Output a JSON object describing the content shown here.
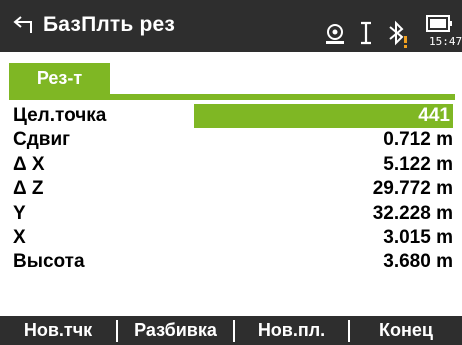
{
  "header": {
    "title": "БазПлть рез",
    "time": "15:47",
    "icons": [
      "back-arrow-icon",
      "target-prism-icon",
      "ir-measure-icon",
      "bluetooth-icon",
      "battery-icon"
    ],
    "warning_color": "#f0a020"
  },
  "tab": {
    "label": "Рез-т"
  },
  "rows": [
    {
      "label": "Цел.точка",
      "value": "441",
      "highlighted": true
    },
    {
      "label": "Сдвиг",
      "value": "0.712 m"
    },
    {
      "label": "Δ X",
      "value": "5.122 m"
    },
    {
      "label": "Δ Z",
      "value": "29.772 m"
    },
    {
      "label": "Y",
      "value": "32.228 m"
    },
    {
      "label": "X",
      "value": "3.015 m"
    },
    {
      "label": "Высота",
      "value": "3.680 m"
    }
  ],
  "softkeys": [
    "Нов.тчк",
    "Разбивка",
    "Нов.пл.",
    "Конец"
  ],
  "colors": {
    "accent": "#7fb724",
    "bar": "#2e2e2e"
  }
}
